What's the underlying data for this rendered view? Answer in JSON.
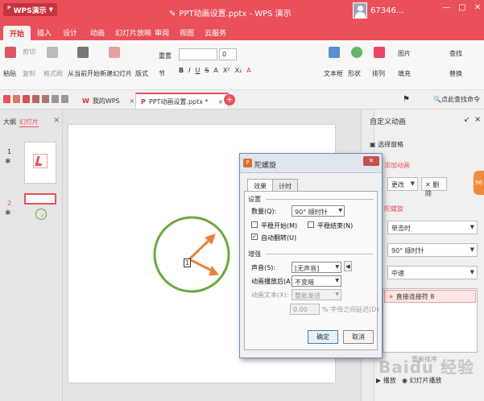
{
  "app": {
    "logo_label": "WPS演示",
    "doc_title": "PPT动画设置.pptx - WPS 演示",
    "user_id": "67346...",
    "win_buttons": [
      "—",
      "□",
      "✕"
    ]
  },
  "tabs": [
    "开始",
    "插入",
    "设计",
    "动画",
    "幻灯片放映",
    "审阅",
    "视图",
    "云服务"
  ],
  "ribbon": {
    "paste": "粘贴",
    "cut": "剪切",
    "copy": "复制",
    "format_brush": "格式刷",
    "from_current": "从当前开始",
    "new_slide": "新建幻灯片",
    "layout": "版式",
    "section": "节",
    "reset": "重置",
    "font_size": "0",
    "text_box": "文本框",
    "shapes": "形状",
    "arrange": "排列",
    "picture": "图片",
    "fill": "填充",
    "find": "查找",
    "replace": "替换",
    "format_buttons": [
      "B",
      "I",
      "U",
      "S",
      "A",
      "X²",
      "X₂",
      "A"
    ]
  },
  "quick_access": {
    "tab_mywps": "我的WPS",
    "tab_doc": "PPT动画设置.pptx *",
    "search_hint": "点此查找命令"
  },
  "left_pane": {
    "tab_outline": "大纲",
    "tab_slides": "幻灯片",
    "slide1_num": "1",
    "slide2_num": "2"
  },
  "slide": {
    "anim_order_label": "1",
    "circle_color": "#6aaa3c",
    "arrow_color": "#e8823a"
  },
  "right_pane": {
    "title": "自定义动画",
    "select_pane": "选择窗格",
    "add_effect": "添加动画",
    "change": "更改",
    "delete": "删除",
    "effect_name": "陀螺旋",
    "start_value": "单击时",
    "amount_value": "90° 顺时针",
    "speed_value": "中速",
    "list_item": "直接连接符 8",
    "reorder": "重新排序",
    "play": "播放",
    "slideshow": "幻灯片播放",
    "orange_tab": "96"
  },
  "dialog": {
    "title": "陀螺旋",
    "close": "✕",
    "tab_effect": "效果",
    "tab_timing": "计时",
    "group_settings": "设置",
    "amount_label": "数量(Q):",
    "amount_value": "90° 顺时针",
    "smooth_start": "平稳开始(M)",
    "smooth_end": "平稳结束(N)",
    "auto_reverse": "自动翻转(U)",
    "group_enhance": "增强",
    "sound_label": "声音(S):",
    "sound_value": "[无声音]",
    "after_anim_label": "动画播放后(A):",
    "after_anim_value": "不变暗",
    "anim_text_label": "动画文本(X):",
    "anim_text_value": "整批发送",
    "delay_value": "0.00",
    "delay_suffix": "% 字母之间延迟(D)",
    "ok": "确定",
    "cancel": "取消"
  },
  "watermark": "Baidu 经验"
}
